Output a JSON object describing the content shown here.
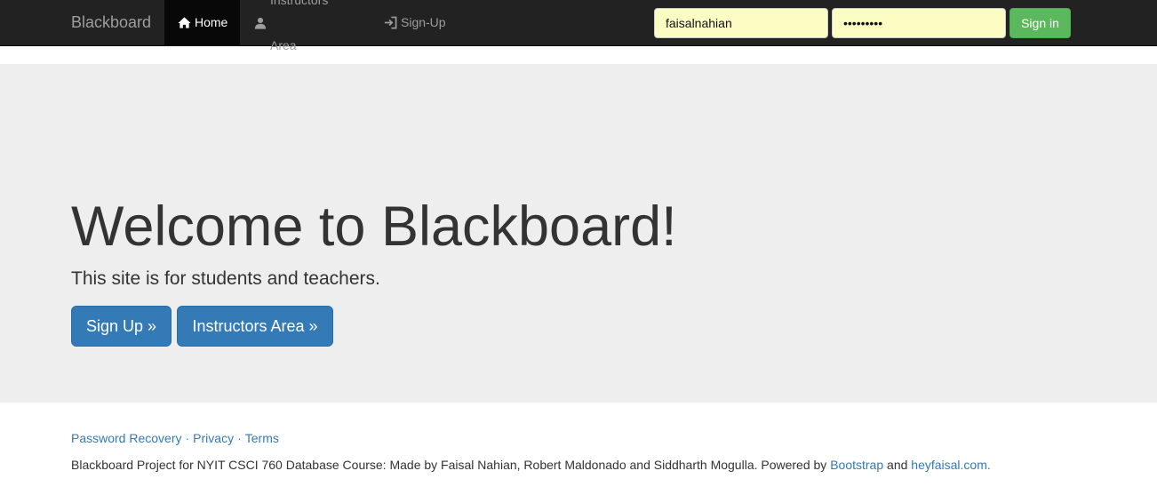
{
  "navbar": {
    "brand": "Blackboard",
    "items": [
      {
        "label": "Home",
        "icon": "home-icon",
        "active": true
      },
      {
        "label": "Instructors Area",
        "icon": "user-icon",
        "active": false
      },
      {
        "label": "Sign-Up",
        "icon": "log-in-icon",
        "active": false
      }
    ],
    "login": {
      "username_value": "faisalnahian",
      "password_value": "•••••••••",
      "signin_label": "Sign in"
    }
  },
  "jumbotron": {
    "title": "Welcome to Blackboard!",
    "lead": "This site is for students and teachers.",
    "signup_button": "Sign Up »",
    "instructors_button": "Instructors Area »"
  },
  "footer": {
    "links": [
      "Password Recovery",
      "Privacy",
      "Terms"
    ],
    "separator": "·",
    "credit_text": "Blackboard Project for NYIT CSCI 760 Database Course: Made by Faisal Nahian, Robert Maldonado and Siddharth Mogulla. Powered by ",
    "bootstrap_link": "Bootstrap",
    "and_text": " and ",
    "heyfaisal_link": "heyfaisal.com."
  },
  "colors": {
    "navbar_bg": "#222222",
    "active_nav_bg": "#080808",
    "input_bg": "#fbfdc2",
    "signin_green": "#5cb85c",
    "primary_blue": "#337ab7",
    "jumbotron_bg": "#eeeeee"
  }
}
